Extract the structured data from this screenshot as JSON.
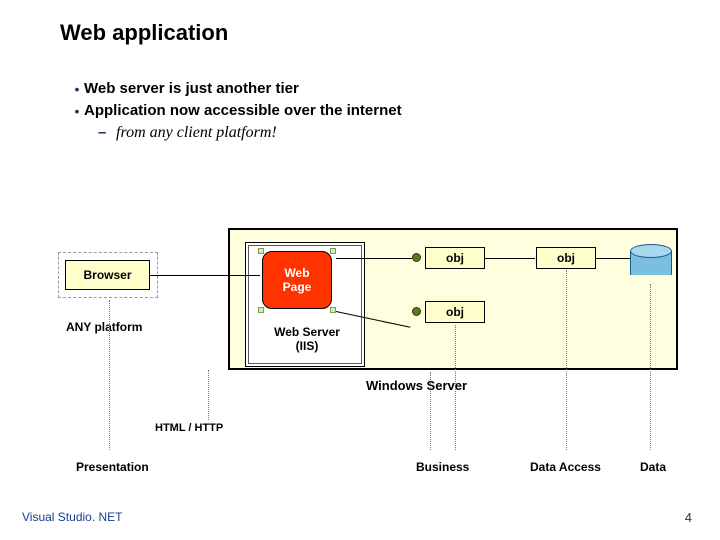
{
  "title": "Web application",
  "bullets": [
    "Web server is just another tier",
    "Application now accessible over the internet"
  ],
  "subbullet": "from any client platform!",
  "diagram": {
    "browser": "Browser",
    "anyPlatform": "ANY platform",
    "webPage": "Web\nPage",
    "webServer": "Web Server (IIS)",
    "obj1": "obj",
    "obj2": "obj",
    "obj3": "obj",
    "windowsServer": "Windows Server",
    "htmlHttp": "HTML / HTTP"
  },
  "tiers": {
    "presentation": "Presentation",
    "business": "Business",
    "dataAccess": "Data Access",
    "data": "Data"
  },
  "footer": "Visual Studio. NET",
  "pageNumber": "4"
}
